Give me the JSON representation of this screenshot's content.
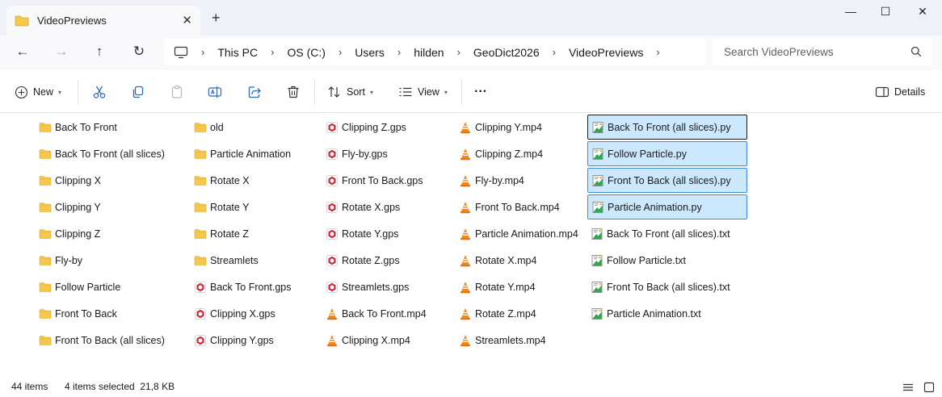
{
  "window": {
    "tab_title": "VideoPreviews",
    "tab_close": "✕",
    "new_tab": "+",
    "controls": {
      "minimize": "—",
      "maximize": "☐",
      "close": "✕"
    }
  },
  "nav": {
    "back": "←",
    "forward": "→",
    "up": "↑",
    "refresh": "↻",
    "breadcrumb": [
      "This PC",
      "OS (C:)",
      "Users",
      "hilden",
      "GeoDict2026",
      "VideoPreviews"
    ],
    "breadcrumb_sep": "›",
    "search_placeholder": "Search VideoPreviews"
  },
  "toolbar": {
    "new_label": "New",
    "sort_label": "Sort",
    "view_label": "View",
    "more_label": "···",
    "details_label": "Details",
    "caret": "▾"
  },
  "files": {
    "col1": [
      {
        "name": "Back To Front",
        "type": "folder"
      },
      {
        "name": "Back To Front (all slices)",
        "type": "folder"
      },
      {
        "name": "Clipping X",
        "type": "folder"
      },
      {
        "name": "Clipping Y",
        "type": "folder"
      },
      {
        "name": "Clipping Z",
        "type": "folder"
      },
      {
        "name": "Fly-by",
        "type": "folder"
      },
      {
        "name": "Follow Particle",
        "type": "folder"
      },
      {
        "name": "Front To Back",
        "type": "folder"
      },
      {
        "name": "Front To Back (all slices)",
        "type": "folder"
      }
    ],
    "col2": [
      {
        "name": "old",
        "type": "folder"
      },
      {
        "name": "Particle Animation",
        "type": "folder"
      },
      {
        "name": "Rotate X",
        "type": "folder"
      },
      {
        "name": "Rotate Y",
        "type": "folder"
      },
      {
        "name": "Rotate Z",
        "type": "folder"
      },
      {
        "name": "Streamlets",
        "type": "folder"
      },
      {
        "name": "Back To Front.gps",
        "type": "gps"
      },
      {
        "name": "Clipping X.gps",
        "type": "gps"
      },
      {
        "name": "Clipping Y.gps",
        "type": "gps"
      }
    ],
    "col3": [
      {
        "name": "Clipping Z.gps",
        "type": "gps"
      },
      {
        "name": "Fly-by.gps",
        "type": "gps"
      },
      {
        "name": "Front To Back.gps",
        "type": "gps"
      },
      {
        "name": "Rotate X.gps",
        "type": "gps"
      },
      {
        "name": "Rotate Y.gps",
        "type": "gps"
      },
      {
        "name": "Rotate Z.gps",
        "type": "gps"
      },
      {
        "name": "Streamlets.gps",
        "type": "gps"
      },
      {
        "name": "Back To Front.mp4",
        "type": "mp4"
      },
      {
        "name": "Clipping X.mp4",
        "type": "mp4"
      }
    ],
    "col4": [
      {
        "name": "Clipping Y.mp4",
        "type": "mp4"
      },
      {
        "name": "Clipping Z.mp4",
        "type": "mp4"
      },
      {
        "name": "Fly-by.mp4",
        "type": "mp4"
      },
      {
        "name": "Front To Back.mp4",
        "type": "mp4"
      },
      {
        "name": "Particle Animation.mp4",
        "type": "mp4"
      },
      {
        "name": "Rotate X.mp4",
        "type": "mp4"
      },
      {
        "name": "Rotate Y.mp4",
        "type": "mp4"
      },
      {
        "name": "Rotate Z.mp4",
        "type": "mp4"
      },
      {
        "name": "Streamlets.mp4",
        "type": "mp4"
      }
    ],
    "col5": [
      {
        "name": "Back To Front (all slices).py",
        "type": "py",
        "selected": true,
        "focused": true
      },
      {
        "name": "Follow Particle.py",
        "type": "py",
        "selected": true
      },
      {
        "name": "Front To Back (all slices).py",
        "type": "py",
        "selected": true
      },
      {
        "name": "Particle Animation.py",
        "type": "py",
        "selected": true
      },
      {
        "name": "Back To Front (all slices).txt",
        "type": "txt"
      },
      {
        "name": "Follow Particle.txt",
        "type": "txt"
      },
      {
        "name": "Front To Back (all slices).txt",
        "type": "txt"
      },
      {
        "name": "Particle Animation.txt",
        "type": "txt"
      }
    ]
  },
  "status": {
    "item_count": "44 items",
    "selection": "4 items selected  21,8 KB"
  },
  "colors": {
    "folder": "#f5c84c",
    "gps": "#c8283c",
    "vlc": "#f08a1c",
    "selection_bg": "#cce8ff",
    "selection_border": "#3b8bd9"
  }
}
